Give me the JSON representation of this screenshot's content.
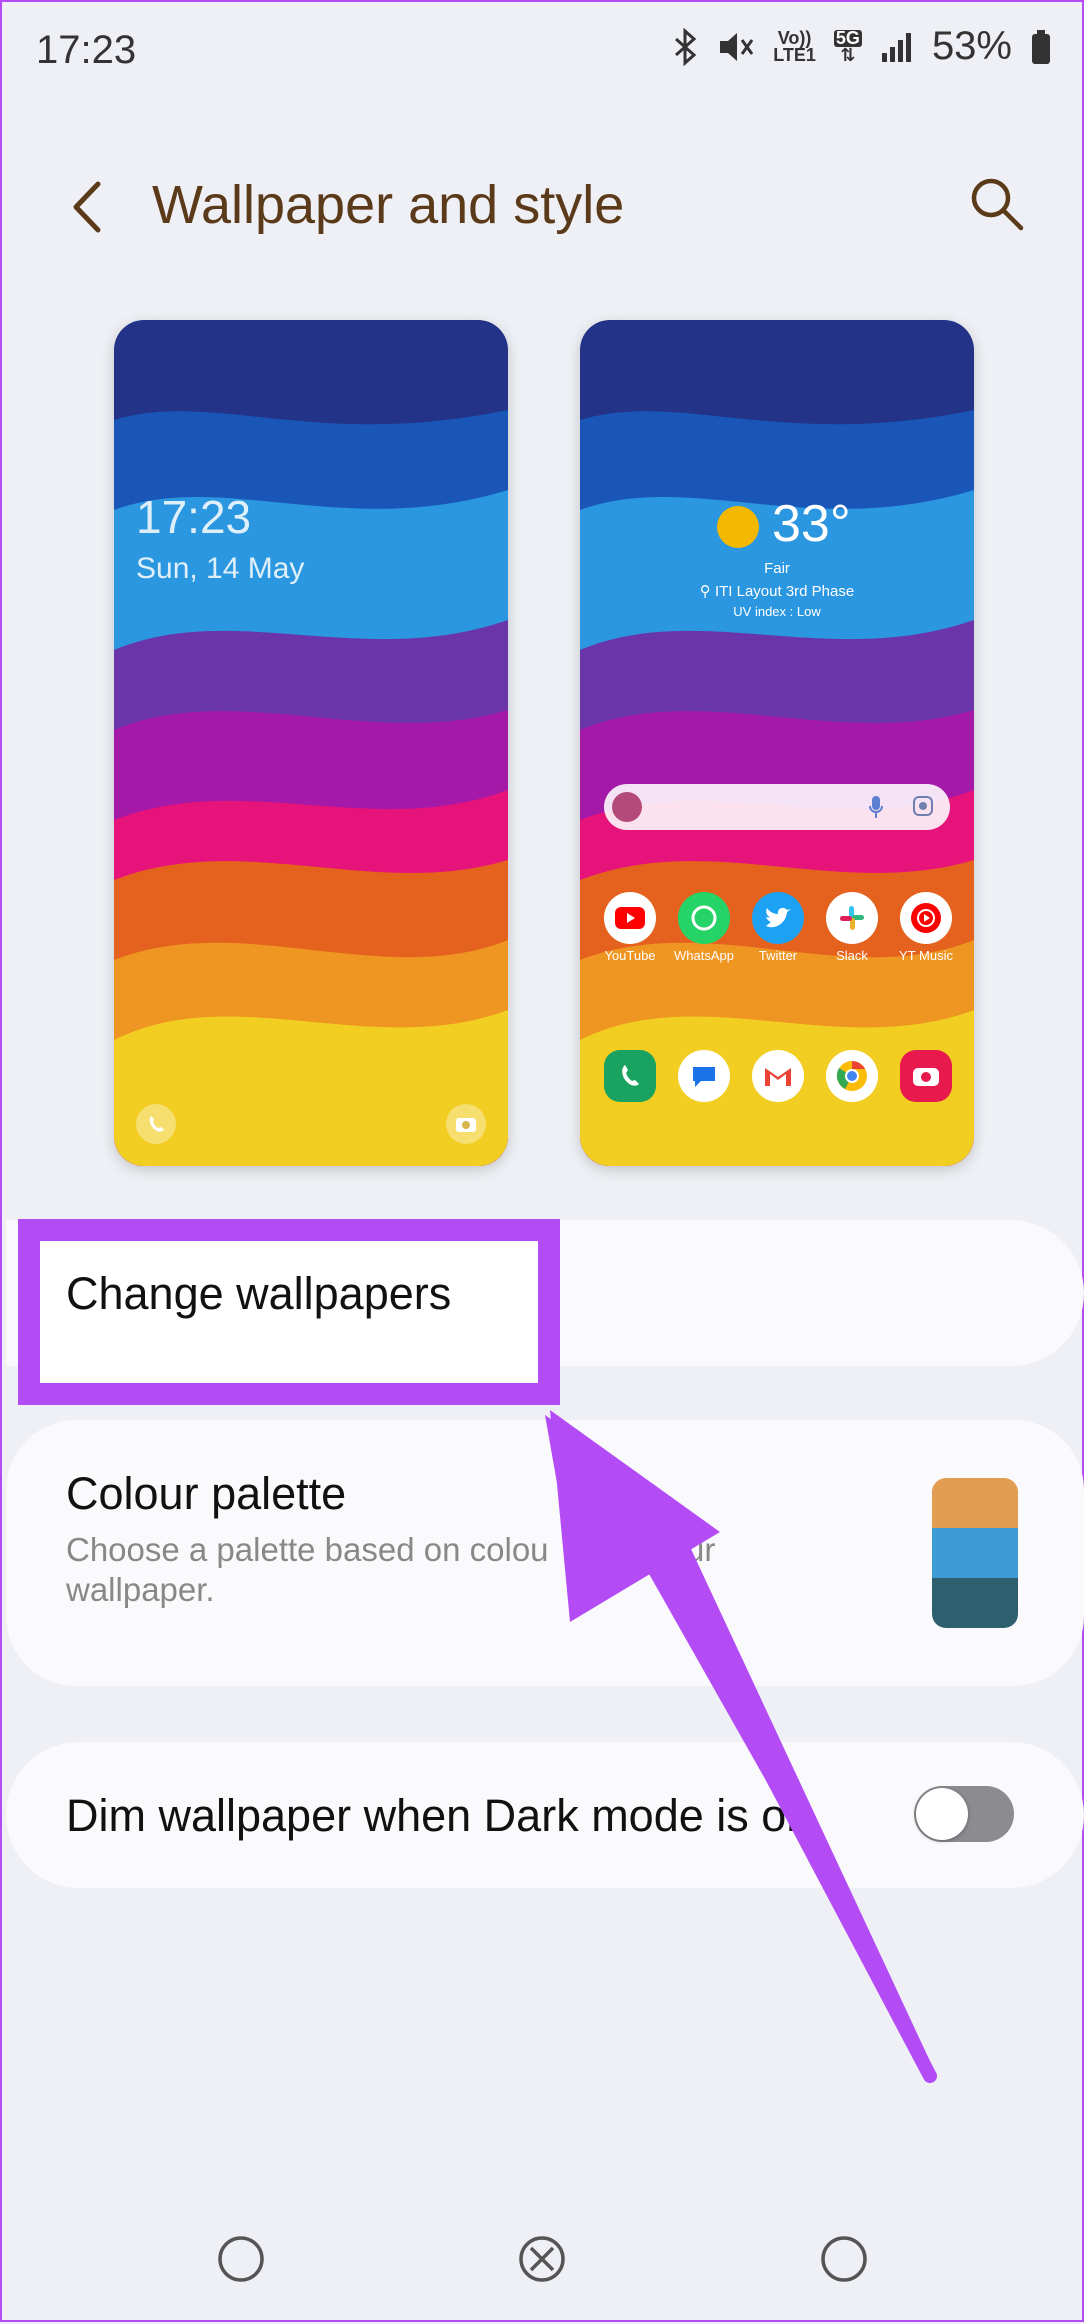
{
  "status_bar": {
    "time": "17:23",
    "battery": "53%",
    "volte_line1": "Vo))",
    "volte_line2": "LTE1",
    "network_badge": "5G"
  },
  "header": {
    "title": "Wallpaper and style",
    "back_icon": "chevron-left-icon",
    "search_icon": "search-icon"
  },
  "lock_preview": {
    "time": "17:23",
    "date": "Sun, 14 May"
  },
  "home_preview": {
    "temperature": "33°",
    "condition": "Fair",
    "location": "ITI Layout 3rd Phase",
    "uv_index": "UV index : Low",
    "apps": [
      {
        "label": "YouTube",
        "color": "#ff0000"
      },
      {
        "label": "WhatsApp",
        "color": "#25d366"
      },
      {
        "label": "Twitter",
        "color": "#1da1f2"
      },
      {
        "label": "Slack",
        "color": "#4a154b"
      },
      {
        "label": "YT Music",
        "color": "#ff0000"
      }
    ],
    "dock": [
      {
        "name": "phone-icon",
        "color": "#1aa260"
      },
      {
        "name": "messages-icon",
        "color": "#1a73e8"
      },
      {
        "name": "gmail-icon",
        "color": "#ea4335"
      },
      {
        "name": "chrome-icon",
        "color": "#fbbc05"
      },
      {
        "name": "camera-icon",
        "color": "#e8194d"
      }
    ]
  },
  "settings": {
    "change_wallpapers": "Change wallpapers",
    "colour_palette_title": "Colour palette",
    "colour_palette_subtitle_1": "Choose a palette based on colou",
    "colour_palette_subtitle_2": "m your",
    "colour_palette_subtitle_3": "wallpaper.",
    "palette_colors": [
      "#e39d52",
      "#3e9bd6",
      "#2e5f6e"
    ],
    "dim_wallpaper_label": "Dim wallpaper when Dark mode is on",
    "dim_wallpaper_enabled": false
  },
  "colors": {
    "accent_highlight": "#b44cf5",
    "title": "#5b3a1a",
    "background": "#eef0f5"
  }
}
